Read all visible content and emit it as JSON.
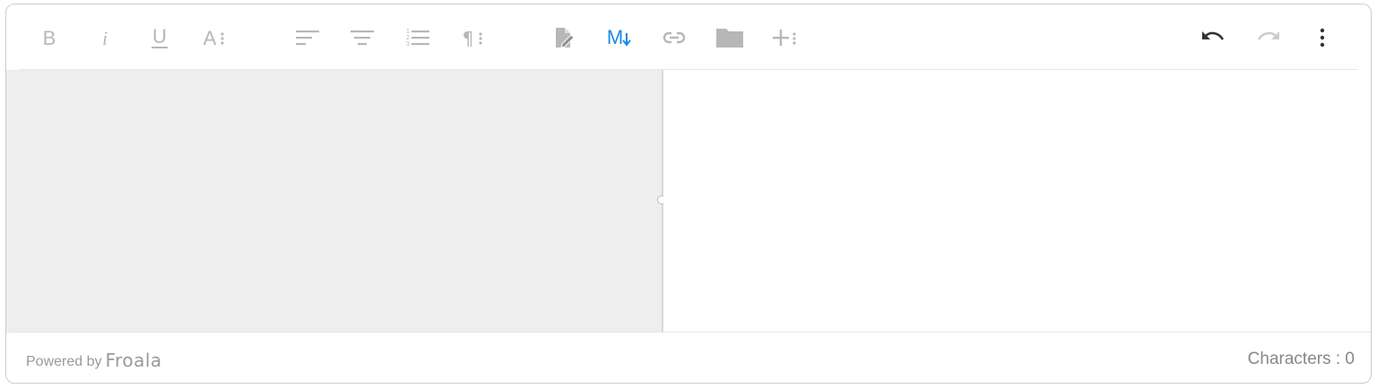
{
  "toolbar": {
    "buttons": [
      {
        "name": "bold-icon",
        "active": false
      },
      {
        "name": "italic-icon",
        "active": false
      },
      {
        "name": "underline-icon",
        "active": false
      },
      {
        "name": "text-format-more-icon",
        "active": false
      },
      {
        "name": "align-left-icon",
        "active": false
      },
      {
        "name": "align-center-icon",
        "active": false
      },
      {
        "name": "ordered-list-icon",
        "active": false
      },
      {
        "name": "paragraph-more-icon",
        "active": false
      },
      {
        "name": "edit-document-icon",
        "active": false
      },
      {
        "name": "markdown-icon",
        "active": true
      },
      {
        "name": "link-icon",
        "active": false
      },
      {
        "name": "folder-icon",
        "active": false
      },
      {
        "name": "insert-more-icon",
        "active": false
      },
      {
        "name": "undo-icon",
        "active": true
      },
      {
        "name": "redo-icon",
        "active": false
      },
      {
        "name": "more-vertical-icon",
        "active": true
      }
    ],
    "labels": {
      "bold": "B",
      "italic": "i",
      "underline": "U",
      "font": "A",
      "markdown": "M"
    }
  },
  "colors": {
    "icon": "#b7b7b7",
    "active": "#333333",
    "accent": "#1e88e5",
    "left_pane": "#eeeeee"
  },
  "footer": {
    "powered_by": "Powered by",
    "brand": "Froala",
    "characters": "Characters : 0"
  }
}
